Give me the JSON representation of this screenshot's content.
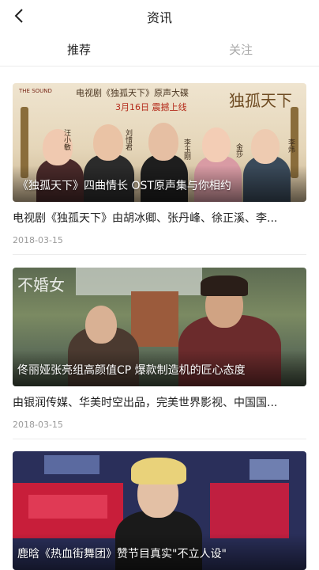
{
  "nav": {
    "title": "资讯",
    "back_icon": "chevron-left-icon"
  },
  "tabs": [
    {
      "label": "推荐",
      "active": true
    },
    {
      "label": "关注",
      "active": false
    }
  ],
  "articles": [
    {
      "caption": "《独孤天下》四曲情长 OST原声集与你相约",
      "summary": "电视剧《独孤天下》由胡冰卿、张丹峰、徐正溪、李...",
      "date": "2018-03-15",
      "image": {
        "logo": "THE SOUND",
        "head_title": "电视剧《独孤天下》原声大碟",
        "release": "3月16日 震撼上线",
        "brand": "独孤天下",
        "names": [
          "汪小敏",
          "刘惜君",
          "李玉刚",
          "金莎",
          "李炜"
        ]
      }
    },
    {
      "caption": "佟丽娅张亮组高颜值CP 爆款制造机的匠心态度",
      "summary": "由银润传媒、华美时空出品，完美世界影视、中国国...",
      "date": "2018-03-15",
      "image": {
        "watermark": "不婚女"
      }
    },
    {
      "caption": "鹿晗《热血街舞团》赞节目真实\"不立人设\"",
      "summary": "",
      "date": "",
      "image": {}
    }
  ]
}
